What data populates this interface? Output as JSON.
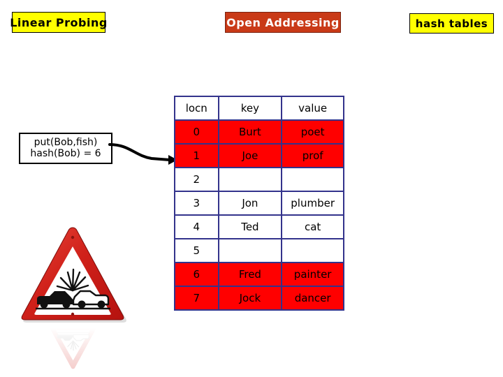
{
  "slide": {
    "titles": {
      "left_label": "Linear Probing",
      "center_label": "Open Addressing",
      "right_label": "hash tables"
    },
    "colors": {
      "highlight_yellow": "#ffff00",
      "accent_red": "#c93a17",
      "table_border": "#33338c",
      "filled_cell": "#ff0000",
      "empty_cell": "#ffffff",
      "text": "#000000"
    }
  },
  "callout": {
    "line1": "put(Bob,fish)",
    "line2": "hash(Bob) = 6",
    "arrow": "curved-arrow-pointing-right"
  },
  "table": {
    "columns": [
      "locn",
      "key",
      "value"
    ],
    "rows": [
      {
        "locn": "0",
        "key": "Burt",
        "value": "poet",
        "filled": true
      },
      {
        "locn": "1",
        "key": "Joe",
        "value": "prof",
        "filled": true
      },
      {
        "locn": "2",
        "key": "",
        "value": "",
        "filled": false
      },
      {
        "locn": "3",
        "key": "Jon",
        "value": "plumber",
        "filled": false
      },
      {
        "locn": "4",
        "key": "Ted",
        "value": "cat",
        "filled": false
      },
      {
        "locn": "5",
        "key": "",
        "value": "",
        "filled": false
      },
      {
        "locn": "6",
        "key": "Fred",
        "value": "painter",
        "filled": true
      },
      {
        "locn": "7",
        "key": "Jock",
        "value": "dancer",
        "filled": true
      }
    ]
  },
  "graphic": {
    "name": "car-collision-warning-sign",
    "has_reflection": true
  }
}
